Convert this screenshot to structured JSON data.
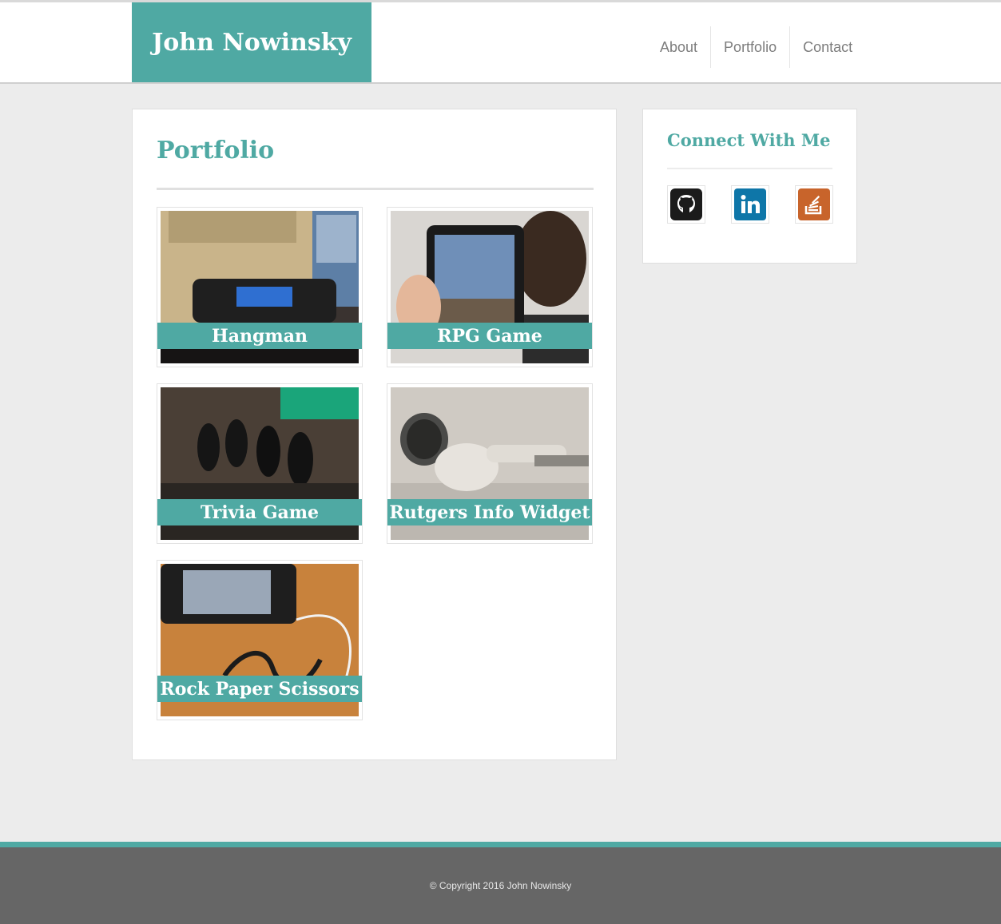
{
  "header": {
    "brand": "John Nowinsky",
    "nav": [
      "About",
      "Portfolio",
      "Contact"
    ]
  },
  "main": {
    "title": "Portfolio",
    "projects": [
      {
        "title": "Hangman",
        "image": "sony-walkman-photo"
      },
      {
        "title": "RPG Game",
        "image": "ipad-person-photo"
      },
      {
        "title": "Trivia Game",
        "image": "circuit-board-photo"
      },
      {
        "title": "Rutgers Info Widget",
        "image": "earbuds-photo"
      },
      {
        "title": "Rock Paper Scissors",
        "image": "phone-headphones-photo"
      }
    ]
  },
  "sidebar": {
    "title": "Connect With Me",
    "social": [
      {
        "name": "github-icon",
        "color": "#1b1b1b"
      },
      {
        "name": "linkedin-icon",
        "color": "#0e76a8"
      },
      {
        "name": "stackoverflow-icon",
        "color": "#c8642b"
      }
    ]
  },
  "footer": {
    "copyright": "© Copyright 2016 John Nowinsky"
  },
  "colors": {
    "accent": "#4fa9a3",
    "footer": "#666666"
  }
}
